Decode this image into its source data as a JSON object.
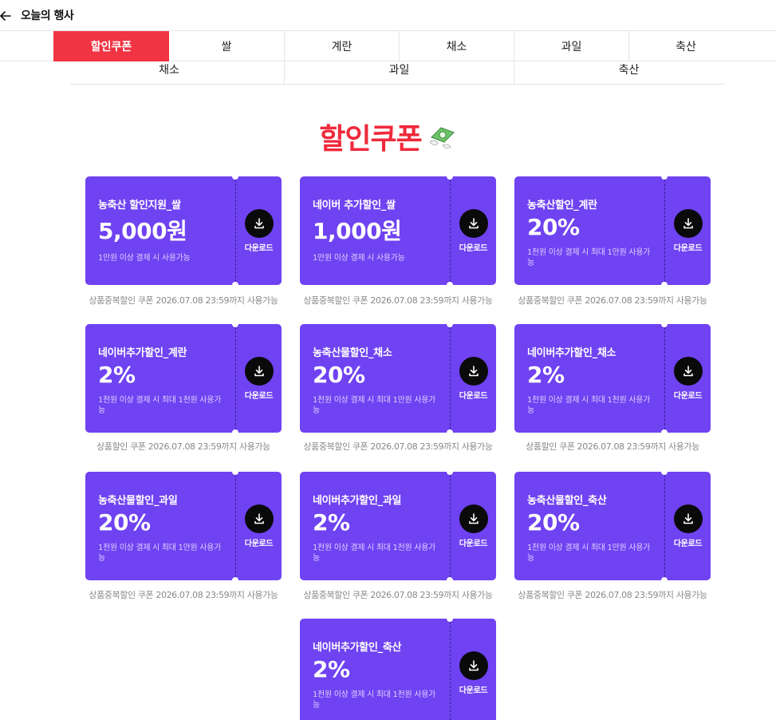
{
  "header": {
    "title": "오늘의 행사"
  },
  "tabs_row1": [
    "할인쿠폰",
    "쌀",
    "계란",
    "채소",
    "과일",
    "축산"
  ],
  "tabs_row2": [
    "채소",
    "과일",
    "축산"
  ],
  "hero": {
    "title": "할인쿠폰"
  },
  "download_label": "다운로드",
  "coupons": [
    {
      "name": "농축산 할인지원_쌀",
      "amount": "5,000원",
      "condition": "1만원 이상 결제 시 사용가능",
      "note": "상품중복할인 쿠폰 2026.07.08 23:59까지 사용가능"
    },
    {
      "name": "네이버 추가할인_쌀",
      "amount": "1,000원",
      "condition": "1만원 이상 결제 시 사용가능",
      "note": "상품중복할인 쿠폰 2026.07.08 23:59까지 사용가능"
    },
    {
      "name": "농축산할인_계란",
      "amount": "20%",
      "condition": "1천원 이상 결제 시 최대 1만원 사용가능",
      "note": "상품중복할인 쿠폰 2026.07.08 23:59까지 사용가능"
    },
    {
      "name": "네이버추가할인_계란",
      "amount": "2%",
      "condition": "1천원 이상 결제 시 최대 1천원 사용가능",
      "note": "상품할인 쿠폰 2026.07.08 23:59까지 사용가능"
    },
    {
      "name": "농축산물할인_채소",
      "amount": "20%",
      "condition": "1천원 이상 결제 시 최대 1만원 사용가능",
      "note": "상품중복할인 쿠폰 2026.07.08 23:59까지 사용가능"
    },
    {
      "name": "네이버추가할인_채소",
      "amount": "2%",
      "condition": "1천원 이상 결제 시 최대 1천원 사용가능",
      "note": "상품할인 쿠폰 2026.07.08 23:59까지 사용가능"
    },
    {
      "name": "농축산물할인_과일",
      "amount": "20%",
      "condition": "1천원 이상 결제 시 최대 1만원 사용가능",
      "note": "상품중복할인 쿠폰 2026.07.08 23:59까지 사용가능"
    },
    {
      "name": "네이버추가할인_과일",
      "amount": "2%",
      "condition": "1천원 이상 결제 시 최대 1천원 사용가능",
      "note": "상품중복할인 쿠폰 2026.07.08 23:59까지 사용가능"
    },
    {
      "name": "농축산물할인_축산",
      "amount": "20%",
      "condition": "1천원 이상 결제 시 최대 1만원 사용가능",
      "note": "상품중복할인 쿠폰 2026.07.08 23:59까지 사용가능"
    },
    {
      "name": "네이버추가할인_축산",
      "amount": "2%",
      "condition": "1천원 이상 결제 시 최대 1천원 사용가능",
      "note": ""
    }
  ],
  "colors": {
    "accent": "#f03443",
    "coupon_bg": "#6f42f2",
    "download_btn": "#0a0a0a"
  },
  "icons": {
    "back": "arrow-left-icon",
    "hero": "money-with-wings-icon",
    "download": "download-icon"
  }
}
